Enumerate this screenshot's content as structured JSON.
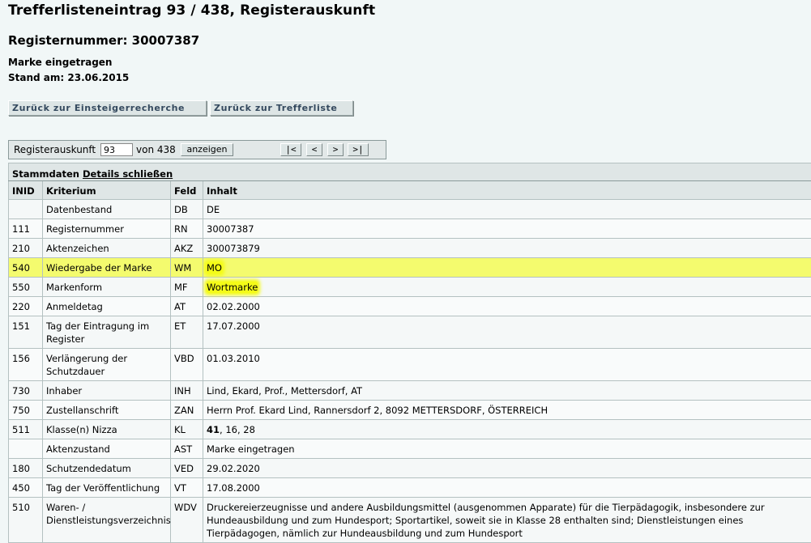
{
  "header": {
    "title": "Trefferlisteneintrag 93 / 438, Registerauskunft",
    "registernummer": "Registernummer: 30007387",
    "status": "Marke eingetragen",
    "stand": "Stand am: 23.06.2015"
  },
  "nav": {
    "back_to_search": "Zurück zur Einsteigerrecherche",
    "back_to_list": "Zurück zur Trefferliste"
  },
  "pager": {
    "label": "Registerauskunft",
    "current_value": "93",
    "of_label": "von 438",
    "show_button": "anzeigen",
    "first": "|<",
    "prev": "<",
    "next": ">",
    "last": ">|"
  },
  "table": {
    "section_title": "Stammdaten",
    "details_link": "Details schließen",
    "columns": [
      "INID",
      "Kriterium",
      "Feld",
      "Inhalt"
    ],
    "rows": [
      {
        "inid": "",
        "kriterium": "Datenbestand",
        "feld": "DB",
        "inhalt": "DE"
      },
      {
        "inid": "111",
        "kriterium": "Registernummer",
        "feld": "RN",
        "inhalt": "30007387"
      },
      {
        "inid": "210",
        "kriterium": "Aktenzeichen",
        "feld": "AKZ",
        "inhalt": "300073879"
      },
      {
        "inid": "540",
        "kriterium": "Wiedergabe der Marke",
        "feld": "WM",
        "inhalt": "MO"
      },
      {
        "inid": "550",
        "kriterium": "Markenform",
        "feld": "MF",
        "inhalt": "Wortmarke"
      },
      {
        "inid": "220",
        "kriterium": "Anmeldetag",
        "feld": "AT",
        "inhalt": "02.02.2000"
      },
      {
        "inid": "151",
        "kriterium": "Tag der Eintragung im Register",
        "feld": "ET",
        "inhalt": "17.07.2000"
      },
      {
        "inid": "156",
        "kriterium": "Verlängerung der Schutzdauer",
        "feld": "VBD",
        "inhalt": "01.03.2010"
      },
      {
        "inid": "730",
        "kriterium": "Inhaber",
        "feld": "INH",
        "inhalt": "Lind, Ekard, Prof., Mettersdorf, AT"
      },
      {
        "inid": "750",
        "kriterium": "Zustellanschrift",
        "feld": "ZAN",
        "inhalt": "Herrn Prof. Ekard Lind, Rannersdorf 2, 8092 METTERSDORF, ÖSTERREICH"
      },
      {
        "inid": "511",
        "kriterium": "Klasse(n) Nizza",
        "feld": "KL",
        "inhalt_bold": "41",
        "inhalt": ", 16, 28"
      },
      {
        "inid": "",
        "kriterium": "Aktenzustand",
        "feld": "AST",
        "inhalt": "Marke eingetragen"
      },
      {
        "inid": "180",
        "kriterium": "Schutzendedatum",
        "feld": "VED",
        "inhalt": "29.02.2020"
      },
      {
        "inid": "450",
        "kriterium": "Tag der Veröffentlichung",
        "feld": "VT",
        "inhalt": "17.08.2000"
      },
      {
        "inid": "510",
        "kriterium": "Waren- / Dienstleistungsverzeichnis",
        "feld": "WDV",
        "inhalt": "Druckereierzeugnisse und andere Ausbildungsmittel (ausgenommen Apparate) für die Tierpädagogik, insbesondere zur Hundeausbildung und zum Hundesport; Sportartikel, soweit sie in Klasse 28 enthalten sind; Dienstleistungen eines Tierpädagogen, nämlich zur Hundeausbildung und zum Hundesport"
      }
    ]
  },
  "highlight_color": "#f4fb18"
}
